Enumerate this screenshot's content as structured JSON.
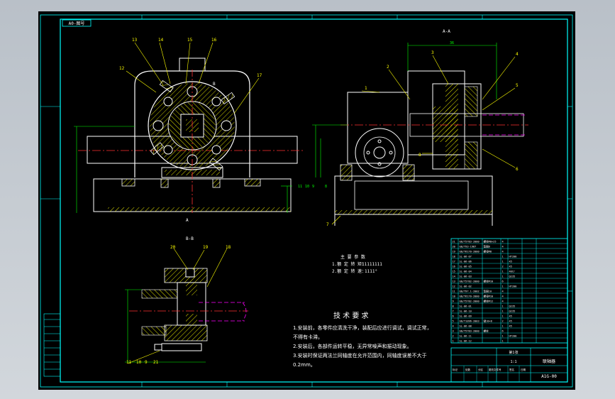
{
  "drawing": {
    "title_stamp": "A0-图号",
    "section_aa": "A-A",
    "section_bb": "B-B",
    "dim_top": "36",
    "balloons_front": [
      "13",
      "14",
      "15",
      "16",
      "12",
      "17"
    ],
    "balloons_side": [
      "3",
      "2",
      "1",
      "4",
      "5",
      "6",
      "7",
      "8"
    ],
    "balloons_bb": [
      "20",
      "19",
      "18"
    ],
    "balloons_bb_bottom": [
      "11",
      "10",
      "9",
      "21"
    ],
    "section_mark": "B",
    "section_mark_low": "A",
    "side_small_labels": [
      "11",
      "10",
      "9",
      "8"
    ]
  },
  "specs": {
    "lines": [
      "主 要 参 数",
      "1.额 定 转 矩：",
      "2.额 定 转 速："
    ],
    "values": [
      "",
      "11111111",
      "1111°"
    ]
  },
  "requirements": {
    "heading": "技 术 要 求",
    "lines": [
      "1.安装前，各零件应清洗干净，装配后应进行调试，调试正常，",
      "  不得有卡滞。",
      "2.安装后，各部件运转平稳，无异常噪声和振动现象。",
      "3.安装时保证两法兰同轴度在允许范围内，同轴度误差不大于",
      "0.2mm。"
    ]
  },
  "parts_list": {
    "rows": [
      [
        "21",
        "GB/T5783-2000",
        "螺栓M8×25",
        "4",
        "",
        "",
        ""
      ],
      [
        "20",
        "GB/T93-1987",
        "垫圈8",
        "4",
        "",
        "",
        ""
      ],
      [
        "19",
        "GB/T6170-2000",
        "螺母M8",
        "4",
        "",
        "",
        ""
      ],
      [
        "18",
        "SL-06-07",
        "",
        "1",
        "HT200",
        "",
        ""
      ],
      [
        "17",
        "SL-06-06",
        "",
        "1",
        "45",
        "",
        ""
      ],
      [
        "16",
        "SL-06-05",
        "",
        "2",
        "45",
        "",
        ""
      ],
      [
        "15",
        "SL-06-04",
        "",
        "1",
        "40Cr",
        "",
        ""
      ],
      [
        "14",
        "SL-06-03",
        "",
        "1",
        "Q235",
        "",
        ""
      ],
      [
        "13",
        "GB/T5782-2000",
        "螺栓M10",
        "6",
        "",
        "",
        ""
      ],
      [
        "12",
        "SL-06-02",
        "",
        "1",
        "HT200",
        "",
        ""
      ],
      [
        "11",
        "GB/T97.1-2002",
        "垫圈10",
        "4",
        "",
        "",
        ""
      ],
      [
        "10",
        "GB/T6170-2000",
        "螺母M10",
        "4",
        "",
        "",
        ""
      ],
      [
        "9",
        "GB/T5782-2000",
        "螺栓M12",
        "4",
        "",
        "",
        ""
      ],
      [
        "8",
        "SL-06-01",
        "",
        "1",
        "Q235",
        "",
        ""
      ],
      [
        "7",
        "SL-06-10",
        "",
        "1",
        "Q235",
        "",
        ""
      ],
      [
        "6",
        "SL-06-09",
        "",
        "1",
        "45",
        "",
        ""
      ],
      [
        "5",
        "GB/T1096-2003",
        "键10×8",
        "2",
        "45",
        "",
        ""
      ],
      [
        "4",
        "SL-06-08",
        "",
        "1",
        "45",
        "",
        ""
      ],
      [
        "3",
        "GB/T5783-2000",
        "螺栓",
        "6",
        "",
        "",
        ""
      ],
      [
        "2",
        "SL-06-11",
        "",
        "1",
        "HT200",
        "",
        ""
      ],
      [
        "1",
        "SL-06-12",
        "",
        "1",
        "",
        "",
        ""
      ]
    ]
  },
  "title_block": {
    "name": "联轴器",
    "code": "A1G-00",
    "scale": "1:1",
    "sheet": "第1张"
  },
  "revision_block": {
    "labels": [
      "标记",
      "处数",
      "分区",
      "更改文件号",
      "签名",
      "日期"
    ]
  },
  "colors": {
    "sheet_bg": "#000000",
    "frame": "#00ffff",
    "part_line": "#ffffff",
    "hatch": "#ffff00",
    "centerline": "#ff3030",
    "shaft_line": "#ff00ff",
    "dimension": "#00ff00",
    "balloon_text": "#ffff00"
  }
}
